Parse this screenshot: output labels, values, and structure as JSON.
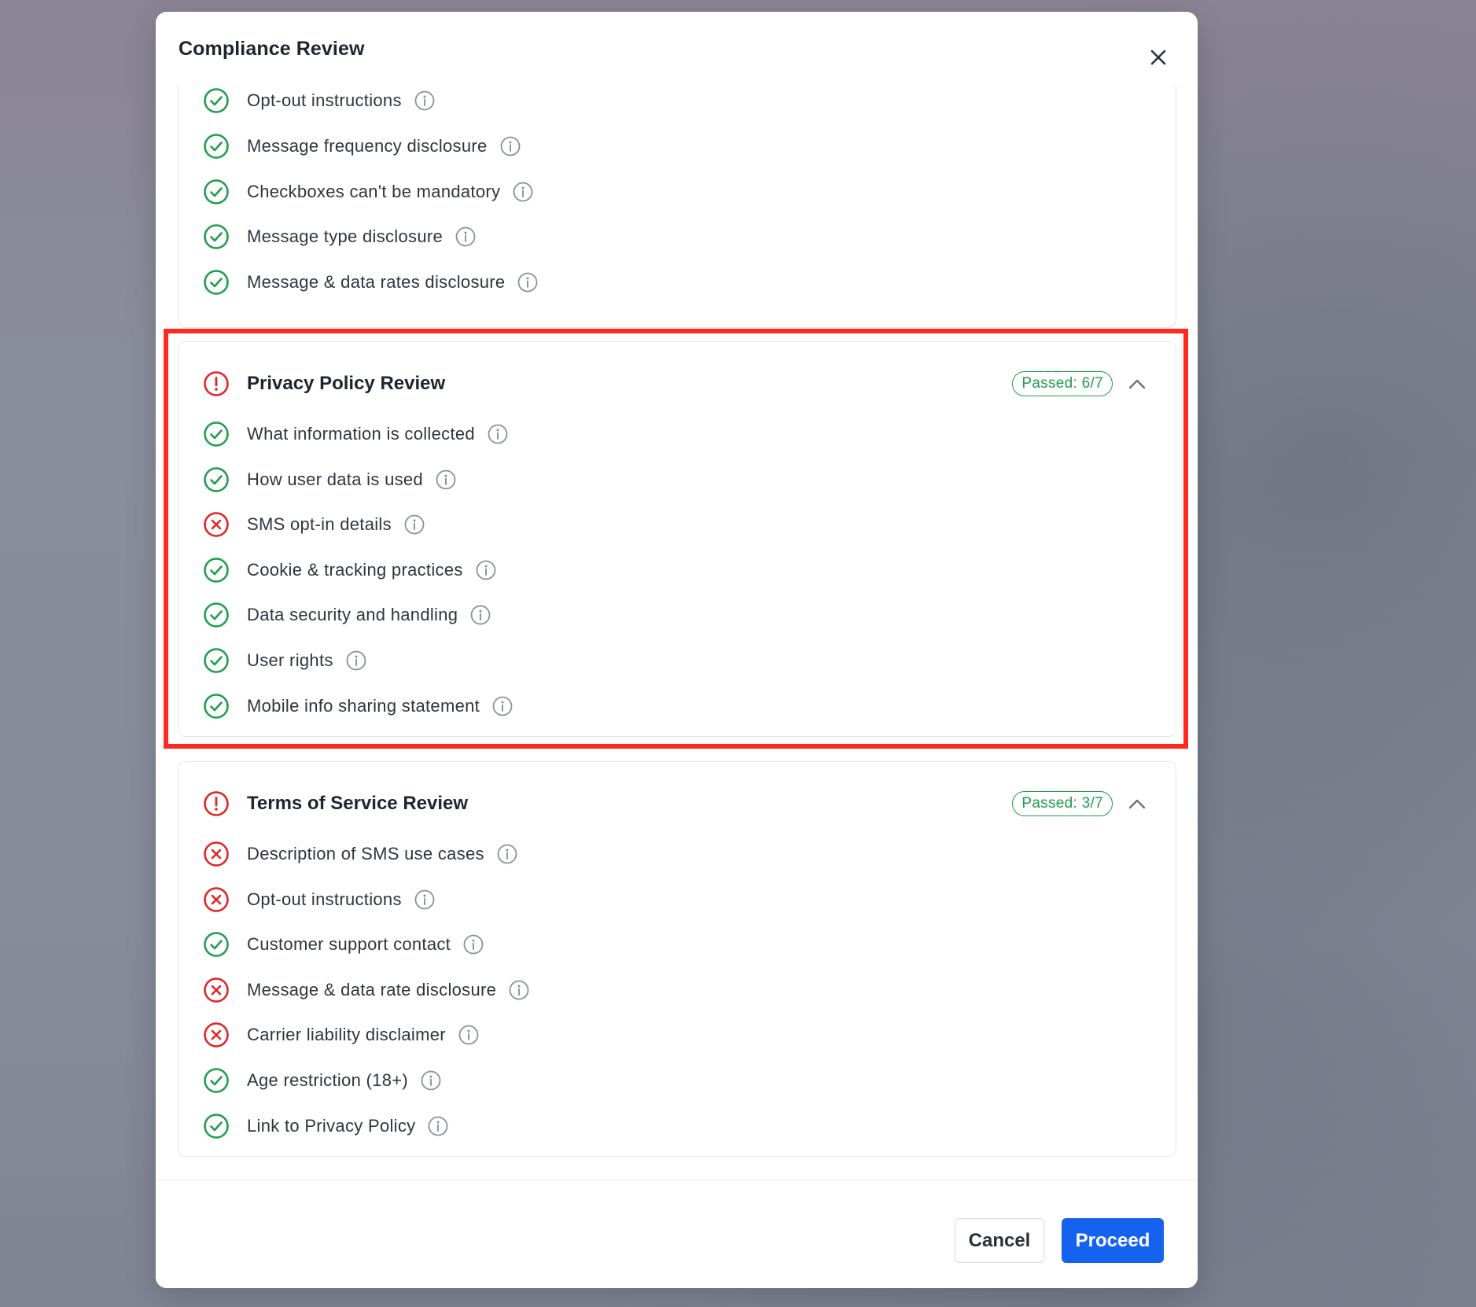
{
  "modal": {
    "title": "Compliance Review"
  },
  "sections": {
    "opt_in": {
      "items": [
        {
          "label": "Opt-out instructions",
          "status": "pass"
        },
        {
          "label": "Message frequency disclosure",
          "status": "pass"
        },
        {
          "label": "Checkboxes can't be mandatory",
          "status": "pass"
        },
        {
          "label": "Message type disclosure",
          "status": "pass"
        },
        {
          "label": "Message & data rates disclosure",
          "status": "pass"
        }
      ]
    },
    "privacy": {
      "title": "Privacy Policy Review",
      "badge": "Passed: 6/7",
      "items": [
        {
          "label": "What information is collected",
          "status": "pass"
        },
        {
          "label": "How user data is used",
          "status": "pass"
        },
        {
          "label": "SMS opt-in details",
          "status": "fail"
        },
        {
          "label": "Cookie & tracking practices",
          "status": "pass"
        },
        {
          "label": "Data security and handling",
          "status": "pass"
        },
        {
          "label": "User rights",
          "status": "pass"
        },
        {
          "label": "Mobile info sharing statement",
          "status": "pass"
        }
      ]
    },
    "terms": {
      "title": "Terms of Service Review",
      "badge": "Passed: 3/7",
      "items": [
        {
          "label": "Description of SMS use cases",
          "status": "fail"
        },
        {
          "label": "Opt-out instructions",
          "status": "fail"
        },
        {
          "label": "Customer support contact",
          "status": "pass"
        },
        {
          "label": "Message & data rate disclosure",
          "status": "fail"
        },
        {
          "label": "Carrier liability disclaimer",
          "status": "fail"
        },
        {
          "label": "Age restriction (18+)",
          "status": "pass"
        },
        {
          "label": "Link to Privacy Policy",
          "status": "pass"
        }
      ]
    }
  },
  "footer": {
    "cancel_label": "Cancel",
    "proceed_label": "Proceed"
  },
  "colors": {
    "pass": "#1f9d4c",
    "fail": "#e02424",
    "primary": "#1462ee",
    "highlight": "#ff2a1f"
  }
}
